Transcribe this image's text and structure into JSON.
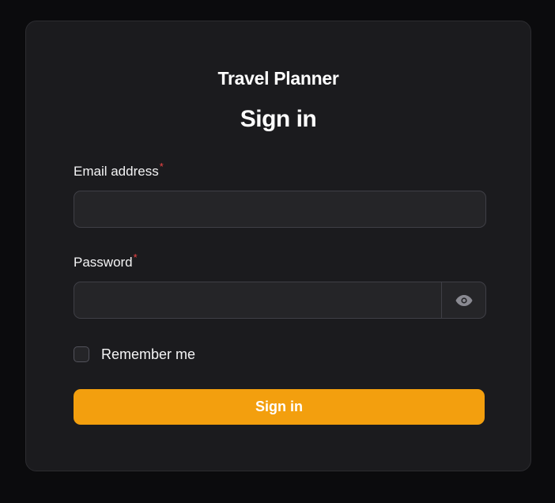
{
  "app": {
    "title": "Travel Planner"
  },
  "form": {
    "heading": "Sign in",
    "email": {
      "label": "Email address",
      "required_marker": "*",
      "value": "",
      "placeholder": ""
    },
    "password": {
      "label": "Password",
      "required_marker": "*",
      "value": "",
      "placeholder": "",
      "toggle_icon": "eye-icon"
    },
    "remember": {
      "label": "Remember me",
      "checked": false
    },
    "submit_label": "Sign in"
  },
  "colors": {
    "page_background": "#0b0b0d",
    "card_background": "#1b1b1e",
    "input_background": "#252528",
    "border": "#3f3f46",
    "accent": "#f39f0e",
    "required": "#ef4444",
    "text": "#f4f4f5"
  }
}
